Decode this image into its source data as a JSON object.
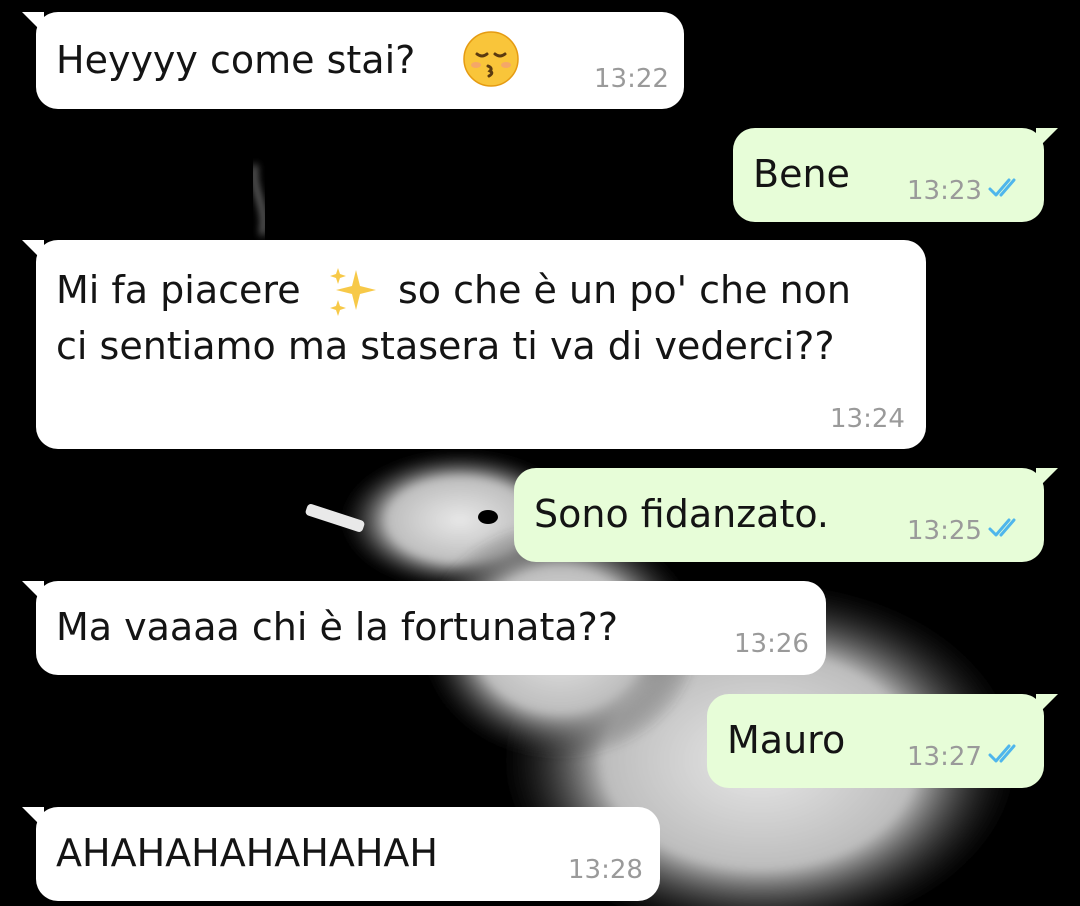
{
  "messages": [
    {
      "direction": "in",
      "text": "Heyyyy come stai?",
      "emoji": "kissing-face-closed-eyes-icon",
      "time": "13:22"
    },
    {
      "direction": "out",
      "text": "Bene",
      "time": "13:23",
      "status": "read-double-check-icon"
    },
    {
      "direction": "in",
      "text_part1": "Mi fa piacere",
      "emoji": "sparkles-icon",
      "text_part2": "so che è un po' che non",
      "text_line2": "ci sentiamo ma stasera ti va di vederci??",
      "time": "13:24"
    },
    {
      "direction": "out",
      "text": "Sono fidanzato.",
      "time": "13:25",
      "status": "read-double-check-icon"
    },
    {
      "direction": "in",
      "text": "Ma vaaaa chi è la fortunata??",
      "time": "13:26"
    },
    {
      "direction": "out",
      "text": "Mauro",
      "time": "13:27",
      "status": "read-double-check-icon"
    },
    {
      "direction": "in",
      "text": "AHAHAHAHAHAHAH",
      "time": "13:28"
    }
  ],
  "colors": {
    "incoming_bubble": "#ffffff",
    "outgoing_bubble": "#e7fdd8",
    "read_ticks": "#4fb6ec",
    "timestamp": "#9a9a9a",
    "background": "#000000"
  }
}
